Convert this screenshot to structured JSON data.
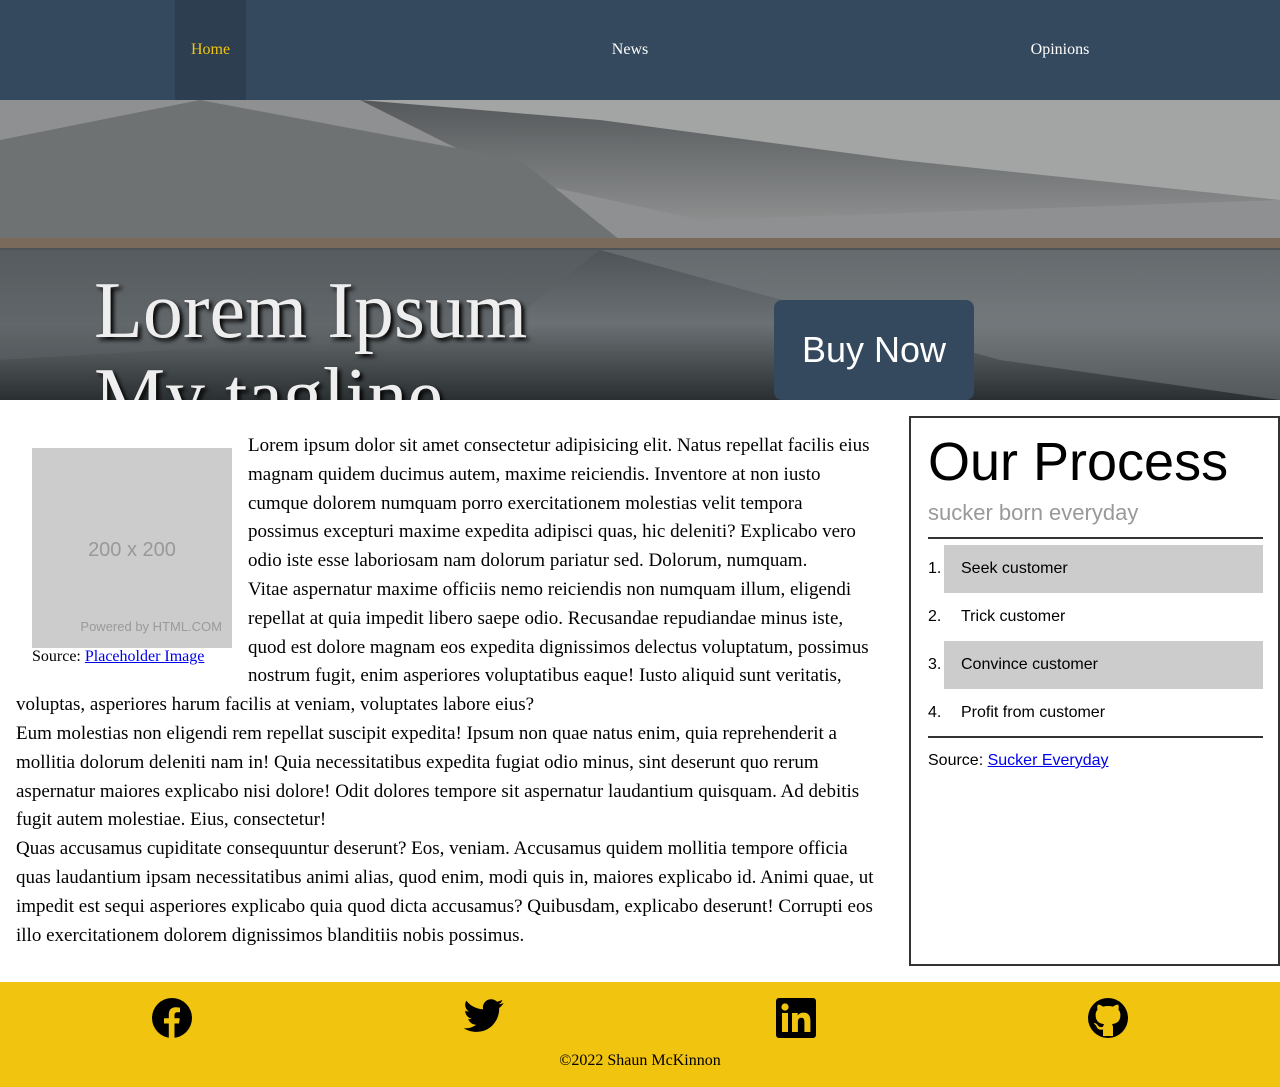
{
  "nav": {
    "items": [
      {
        "label": "Home",
        "active": true
      },
      {
        "label": "News",
        "active": false
      },
      {
        "label": "Opinions",
        "active": false
      }
    ]
  },
  "hero": {
    "title_line1": "Lorem Ipsum",
    "title_line2": "My tagline",
    "cta_label": "Buy Now"
  },
  "figure": {
    "placeholder_size": "200 x 200",
    "placeholder_powered": "Powered by HTML.COM",
    "caption_prefix": "Source: ",
    "caption_link": "Placeholder Image"
  },
  "article": {
    "paragraphs": [
      "Lorem ipsum dolor sit amet consectetur adipisicing elit. Natus repellat facilis eius magnam quidem ducimus autem, maxime reiciendis. Inventore at non iusto cumque dolorem numquam porro exercitationem molestias velit tempora possimus excepturi maxime expedita adipisci quas, hic deleniti? Explicabo vero odio iste esse laboriosam nam dolorum pariatur sed. Dolorum, numquam.",
      "Vitae aspernatur maxime officiis nemo reiciendis non numquam illum, eligendi repellat at quia impedit libero saepe odio. Recusandae repudiandae minus iste, quod est dolore magnam eos expedita dignissimos delectus voluptatum, possimus nostrum fugit, enim asperiores voluptatibus eaque! Iusto aliquid sunt veritatis, voluptas, asperiores harum facilis at veniam, voluptates labore eius?",
      "Eum molestias non eligendi rem repellat suscipit expedita! Ipsum non quae natus enim, quia reprehenderit a mollitia dolorum deleniti nam in! Quia necessitatibus expedita fugiat odio minus, sint deserunt quo rerum aspernatur maiores explicabo nisi dolore! Odit dolores tempore sit aspernatur laudantium quisquam. Ad debitis fugit autem molestiae. Eius, consectetur!",
      "Quas accusamus cupiditate consequuntur deserunt? Eos, veniam. Accusamus quidem mollitia tempore officia quas laudantium ipsam necessitatibus animi alias, quod enim, modi quis in, maiores explicabo id. Animi quae, ut impedit est sequi asperiores explicabo quia quod dicta accusamus? Quibusdam, explicabo deserunt! Corrupti eos illo exercitationem dolorem dignissimos blanditiis nobis possimus."
    ]
  },
  "aside": {
    "title": "Our Process",
    "subtitle": "sucker born everyday",
    "steps": [
      {
        "num": "1.",
        "label": "Seek customer"
      },
      {
        "num": "2.",
        "label": "Trick customer"
      },
      {
        "num": "3.",
        "label": "Convince customer"
      },
      {
        "num": "4.",
        "label": "Profit from customer"
      }
    ],
    "source_prefix": "Source: ",
    "source_link": "Sucker Everyday"
  },
  "footer": {
    "icons": [
      "facebook-icon",
      "twitter-icon",
      "linkedin-icon",
      "github-icon"
    ],
    "copyright": "©2022 Shaun McKinnon"
  },
  "colors": {
    "nav_bg": "#34495e",
    "nav_active_bg": "#2c3e50",
    "accent_yellow": "#f1c40f",
    "cta_bg": "#34495e"
  }
}
